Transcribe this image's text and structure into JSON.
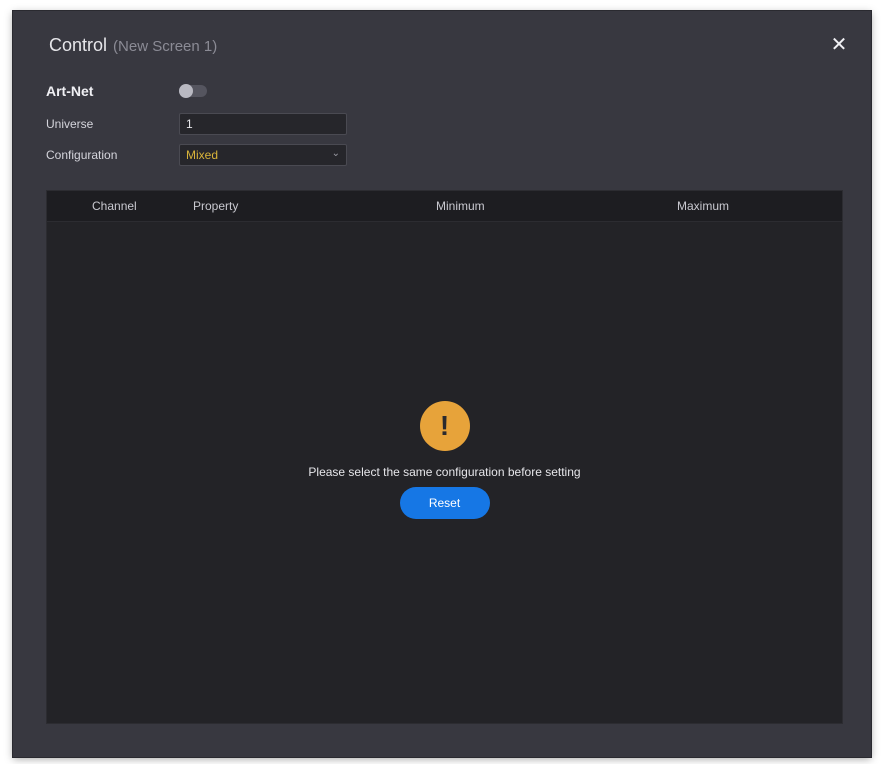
{
  "dialog": {
    "title": "Control",
    "subtitle": "(New Screen 1)",
    "close_glyph": "✕",
    "close_icon": "close-icon"
  },
  "form": {
    "artnet_label": "Art-Net",
    "artnet_enabled": false,
    "universe_label": "Universe",
    "universe_value": "1",
    "configuration_label": "Configuration",
    "configuration_value": "Mixed",
    "configuration_chevron": "⌄"
  },
  "table": {
    "columns": [
      "Channel",
      "Property",
      "Minimum",
      "Maximum"
    ]
  },
  "empty_state": {
    "icon": "warning-icon",
    "icon_glyph": "!",
    "message": "Please select the same configuration before setting",
    "reset_label": "Reset"
  },
  "colors": {
    "dialog_bg": "#383840",
    "panel_bg": "#232327",
    "accent_blue": "#1677e5",
    "warning_orange": "#e7a33a",
    "select_value": "#d9b43a"
  }
}
